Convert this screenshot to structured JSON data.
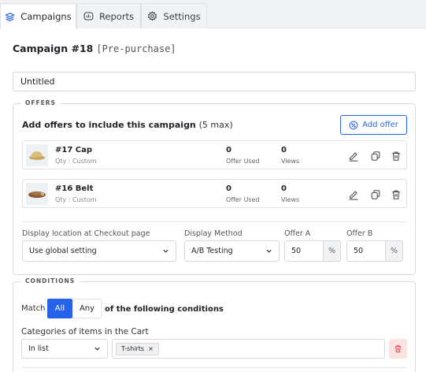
{
  "tabs": [
    {
      "label": "Campaigns",
      "icon": "layers-icon",
      "active": true
    },
    {
      "label": "Reports",
      "icon": "chart-icon",
      "active": false
    },
    {
      "label": "Settings",
      "icon": "gear-icon",
      "active": false
    }
  ],
  "campaign": {
    "title": "Campaign #18",
    "status_tag": "[Pre-purchase]",
    "name_value": "Untitled"
  },
  "offers_section": {
    "legend": "OFFERS",
    "heading": "Add offers to include this campaign",
    "max_note": "(5 max)",
    "add_button": "Add offer",
    "items": [
      {
        "name": "#17 Cap",
        "qty": "Qty : Custom",
        "offer_used": "0",
        "offer_used_label": "Offer Used",
        "views": "0",
        "views_label": "Views"
      },
      {
        "name": "#16 Belt",
        "qty": "Qty : Custom",
        "offer_used": "0",
        "offer_used_label": "Offer Used",
        "views": "0",
        "views_label": "Views"
      }
    ]
  },
  "display": {
    "location_label": "Display location at Checkout page",
    "location_value": "Use global setting",
    "method_label": "Display Method",
    "method_value": "A/B Testing",
    "offer_a_label": "Offer A",
    "offer_a_value": "50",
    "offer_b_label": "Offer B",
    "offer_b_value": "50",
    "unit": "%"
  },
  "conditions": {
    "legend": "CONDITIONS",
    "match_label": "Match",
    "all_label": "All",
    "any_label": "Any",
    "match_tail": "of the following conditions",
    "category_label": "Categories of items in the Cart",
    "operator_value": "In list",
    "chip_label": "T-shirts",
    "chip_remove": "×"
  },
  "colors": {
    "accent": "#2563eb",
    "danger": "#e5484d",
    "danger_bg": "#fde4e4"
  }
}
